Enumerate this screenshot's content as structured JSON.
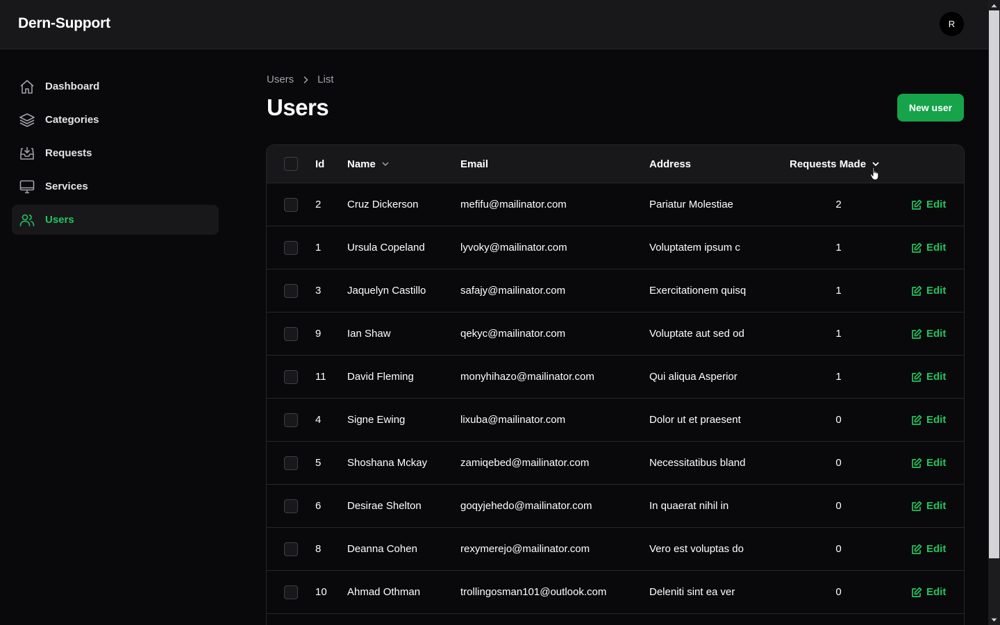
{
  "app": {
    "brand": "Dern-Support",
    "avatar_initial": "R"
  },
  "sidebar": {
    "items": [
      {
        "label": "Dashboard",
        "icon": "home-icon",
        "active": false
      },
      {
        "label": "Categories",
        "icon": "layers-icon",
        "active": false
      },
      {
        "label": "Requests",
        "icon": "inbox-icon",
        "active": false
      },
      {
        "label": "Services",
        "icon": "monitor-icon",
        "active": false
      },
      {
        "label": "Users",
        "icon": "users-icon",
        "active": true
      }
    ]
  },
  "breadcrumb": {
    "items": [
      "Users",
      "List"
    ]
  },
  "page": {
    "title": "Users",
    "new_button_label": "New user"
  },
  "table": {
    "headers": {
      "id": "Id",
      "name": "Name",
      "email": "Email",
      "address": "Address",
      "requests": "Requests Made"
    },
    "edit_label": "Edit",
    "rows": [
      {
        "id": "2",
        "name": "Cruz Dickerson",
        "email": "mefifu@mailinator.com",
        "address": "Pariatur Molestiae",
        "requests": "2"
      },
      {
        "id": "1",
        "name": "Ursula Copeland",
        "email": "lyvoky@mailinator.com",
        "address": "Voluptatem ipsum c",
        "requests": "1"
      },
      {
        "id": "3",
        "name": "Jaquelyn Castillo",
        "email": "safajy@mailinator.com",
        "address": "Exercitationem quisq",
        "requests": "1"
      },
      {
        "id": "9",
        "name": "Ian Shaw",
        "email": "qekyc@mailinator.com",
        "address": "Voluptate aut sed od",
        "requests": "1"
      },
      {
        "id": "11",
        "name": "David Fleming",
        "email": "monyhihazo@mailinator.com",
        "address": "Qui aliqua Asperior",
        "requests": "1"
      },
      {
        "id": "4",
        "name": "Signe Ewing",
        "email": "lixuba@mailinator.com",
        "address": "Dolor ut et praesent",
        "requests": "0"
      },
      {
        "id": "5",
        "name": "Shoshana Mckay",
        "email": "zamiqebed@mailinator.com",
        "address": "Necessitatibus bland",
        "requests": "0"
      },
      {
        "id": "6",
        "name": "Desirae Shelton",
        "email": "goqyjehedo@mailinator.com",
        "address": "In quaerat nihil in",
        "requests": "0"
      },
      {
        "id": "8",
        "name": "Deanna Cohen",
        "email": "rexymerejo@mailinator.com",
        "address": "Vero est voluptas do",
        "requests": "0"
      },
      {
        "id": "10",
        "name": "Ahmad Othman",
        "email": "trollingosman101@outlook.com",
        "address": "Deleniti sint ea ver",
        "requests": "0"
      }
    ]
  },
  "colors": {
    "accent": "#22c55e",
    "button": "#16a34a",
    "background": "#09090b",
    "surface": "#18181b",
    "border": "#27272a"
  }
}
